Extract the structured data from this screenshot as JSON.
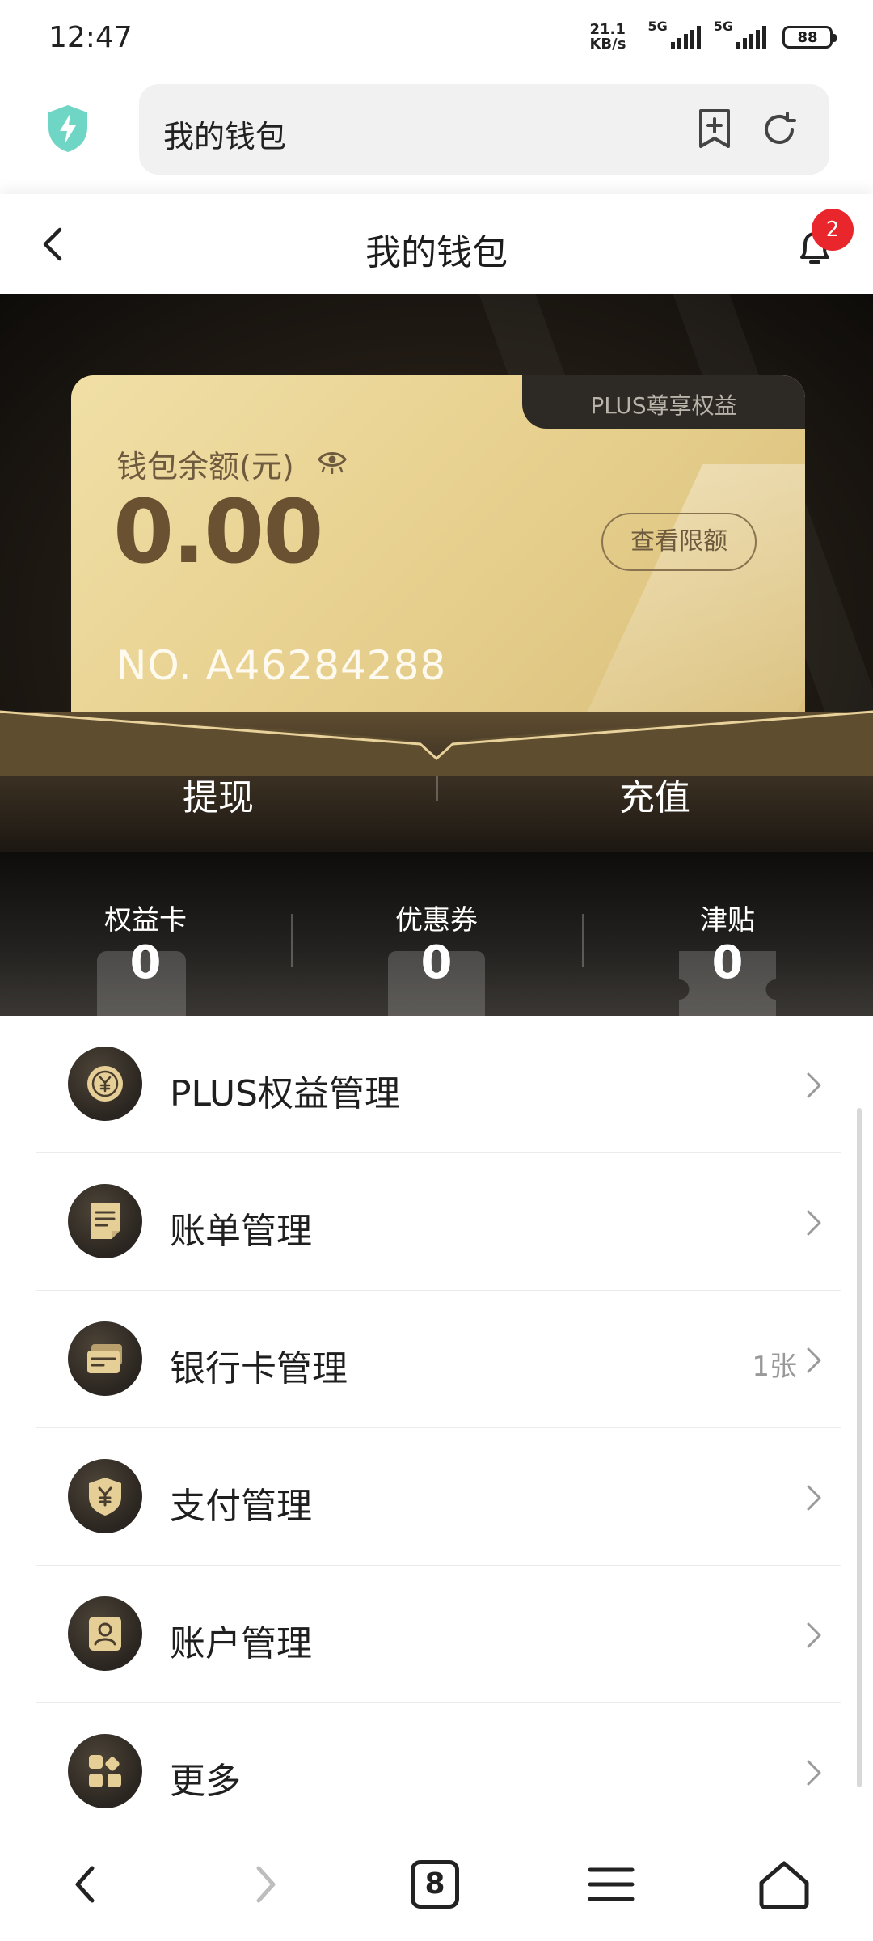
{
  "status_bar": {
    "time": "12:47",
    "net_speed_value": "21.1",
    "net_speed_unit": "KB/s",
    "sim1": "5G",
    "sim2": "5G",
    "battery": "88"
  },
  "browser": {
    "url_text": "我的钱包",
    "icons": [
      "shield-bolt-icon",
      "bookmark-add-icon",
      "reload-icon"
    ]
  },
  "header": {
    "title": "我的钱包",
    "notification_count": "2"
  },
  "card": {
    "tab_label": "PLUS尊享权益",
    "balance_label": "钱包余额(元)",
    "balance": "0.00",
    "limit_button": "查看限额",
    "card_number": "NO. A46284288",
    "colors": {
      "gold": "#e8d190",
      "brown_text": "#6a5131"
    }
  },
  "actions": {
    "withdraw": "提现",
    "recharge": "充值"
  },
  "stats": [
    {
      "label": "权益卡",
      "value": "0"
    },
    {
      "label": "优惠券",
      "value": "0"
    },
    {
      "label": "津贴",
      "value": "0"
    }
  ],
  "menu": [
    {
      "label": "PLUS权益管理",
      "extra": "",
      "icon": "plus-coin-icon"
    },
    {
      "label": "账单管理",
      "extra": "",
      "icon": "bill-icon"
    },
    {
      "label": "银行卡管理",
      "extra": "1张",
      "icon": "bank-card-icon"
    },
    {
      "label": "支付管理",
      "extra": "",
      "icon": "payment-shield-icon"
    },
    {
      "label": "账户管理",
      "extra": "",
      "icon": "account-icon"
    },
    {
      "label": "更多",
      "extra": "",
      "icon": "more-grid-icon"
    }
  ],
  "bottom_nav": {
    "tab_count": "8",
    "icons": [
      "back-icon",
      "forward-icon",
      "tabs-icon",
      "menu-icon",
      "home-icon"
    ]
  }
}
